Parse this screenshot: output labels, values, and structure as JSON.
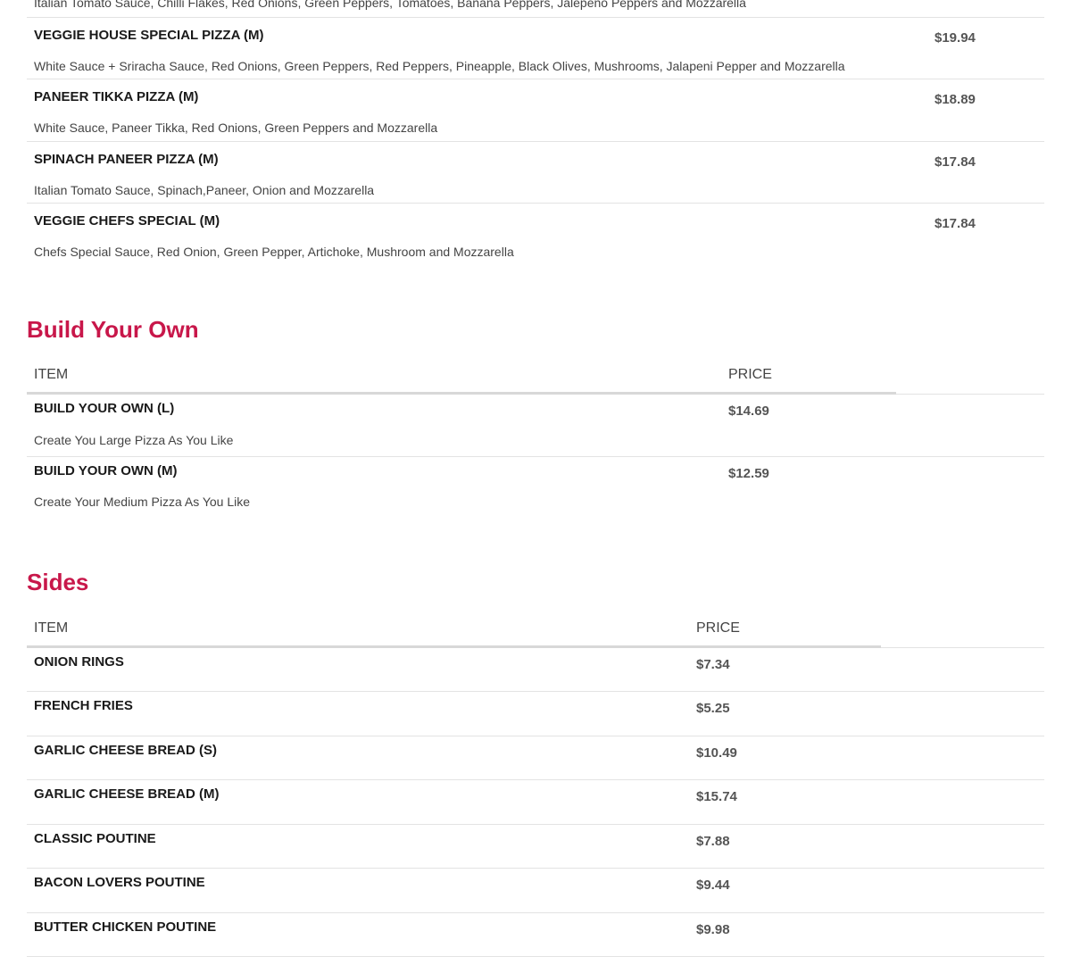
{
  "pizzas": [
    {
      "name": "",
      "desc": "Italian Tomato Sauce, Chilli Flakes, Red Onions, Green Peppers, Tomatoes, Banana Peppers, Jalepeno Peppers and Mozzarella",
      "price": ""
    },
    {
      "name": "VEGGIE HOUSE SPECIAL PIZZA (M)",
      "desc": "White Sauce + Sriracha Sauce, Red Onions, Green Peppers, Red Peppers, Pineapple, Black Olives, Mushrooms, Jalapeni Pepper and Mozzarella",
      "price": "$19.94"
    },
    {
      "name": "PANEER TIKKA PIZZA (M)",
      "desc": "White Sauce, Paneer Tikka, Red Onions, Green Peppers and Mozzarella",
      "price": "$18.89"
    },
    {
      "name": "SPINACH PANEER PIZZA (M)",
      "desc": "Italian Tomato Sauce, Spinach,Paneer, Onion and Mozzarella",
      "price": "$17.84"
    },
    {
      "name": "VEGGIE CHEFS SPECIAL (M)",
      "desc": "Chefs Special Sauce, Red Onion, Green Pepper, Artichoke, Mushroom and Mozzarella",
      "price": "$17.84"
    }
  ],
  "build": {
    "title": "Build Your Own",
    "col_item": "ITEM",
    "col_price": "PRICE",
    "items": [
      {
        "name": "BUILD YOUR OWN (L)",
        "desc": "Create You Large Pizza As You Like",
        "price": "$14.69"
      },
      {
        "name": "BUILD YOUR OWN (M)",
        "desc": "Create Your Medium Pizza As You Like",
        "price": "$12.59"
      }
    ]
  },
  "sides": {
    "title": "Sides",
    "col_item": "ITEM",
    "col_price": "PRICE",
    "items": [
      {
        "name": "ONION RINGS",
        "price": "$7.34"
      },
      {
        "name": "FRENCH FRIES",
        "price": "$5.25"
      },
      {
        "name": "GARLIC CHEESE BREAD (S)",
        "price": "$10.49"
      },
      {
        "name": "GARLIC CHEESE BREAD (M)",
        "price": "$15.74"
      },
      {
        "name": "CLASSIC POUTINE",
        "price": "$7.88"
      },
      {
        "name": "BACON LOVERS POUTINE",
        "price": "$9.44"
      },
      {
        "name": "BUTTER CHICKEN POUTINE",
        "price": "$9.98"
      }
    ]
  },
  "colors": {
    "accent": "#c8174a"
  }
}
